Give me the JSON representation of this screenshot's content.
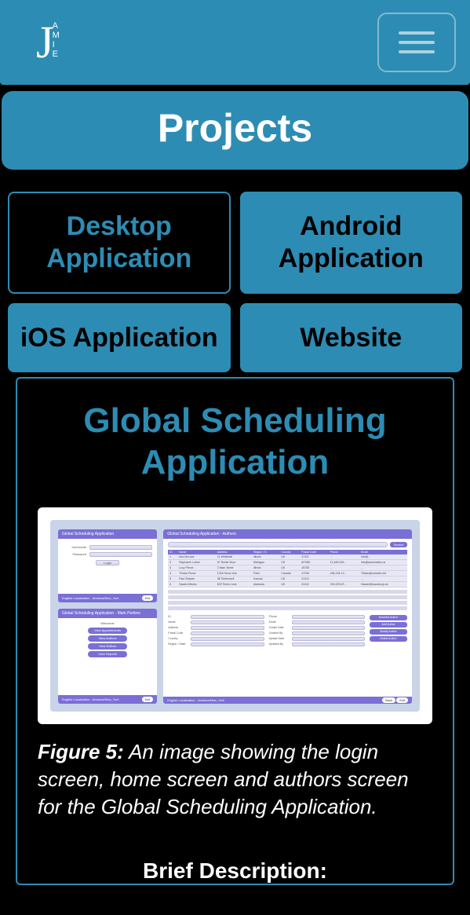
{
  "brand": {
    "letter": "J",
    "stack": [
      "A",
      "M",
      "I",
      "E"
    ]
  },
  "page_title": "Projects",
  "tabs": [
    {
      "label": "Desktop Application",
      "active": true
    },
    {
      "label": "Android Application",
      "active": false
    },
    {
      "label": "iOS Application",
      "active": false
    },
    {
      "label": "Website",
      "active": false
    }
  ],
  "project": {
    "title": "Global Scheduling Application",
    "figure_label": "Figure 5:",
    "figure_caption": "An image showing the login screen, home screen and authors screen for the Global Scheduling Application.",
    "brief_heading": "Brief Description:"
  },
  "mock": {
    "login_title": "Global Scheduling Application",
    "login_user": "Username",
    "login_pass": "Password",
    "login_btn": "Login",
    "footer_loc": "English Localization - America/New_York",
    "footer_pill": "Exit",
    "menu_title": "Global Scheduling Application - Mark Perkins",
    "menu_welcome": "Welcome!",
    "menu_items": [
      "View Appointments",
      "View Authors",
      "View Editors",
      "View Reports"
    ],
    "authors_title": "Global Scheduling Application - Authors",
    "search_btn": "Search",
    "table_headers": [
      "ID",
      "Name",
      "Address",
      "Region / S..",
      "Country",
      "Postal Code",
      "Phone",
      "Email"
    ],
    "table_rows": [
      [
        "1",
        "Ava McLane",
        "21 Whitehall",
        "Illinois",
        "US",
        "17321",
        "...",
        "info@..."
      ],
      [
        "2",
        "Stephanie Luthor",
        "67 Rustin Moor",
        "Michigan",
        "US",
        "AF18B",
        "11-445-515...",
        "info@automation.us"
      ],
      [
        "3",
        "Lucy Pierce",
        "2 Main Street",
        "Illinois",
        "US",
        "15735",
        "...",
        "..."
      ],
      [
        "4",
        "Tristan Pierce",
        "122A Huron Ave",
        "Paris",
        "Canada",
        "17245",
        "436-234-12...",
        "Tristan@canweb.net"
      ],
      [
        "5",
        "Paul Shepler",
        "38 Timberwell",
        "Kansas",
        "US",
        "21312",
        "...",
        "..."
      ],
      [
        "6",
        "Hazard Mkoko",
        "629 Times Lane",
        "Alabama",
        "US",
        "21312",
        "215-678-87...",
        "Hazard@socalcorp.za"
      ]
    ],
    "form_left": [
      "ID",
      "Name",
      "Address",
      "Postal Code",
      "Country",
      "Region / State"
    ],
    "form_right": [
      "Phone",
      "Email",
      "Create Date",
      "Created By",
      "Update Date",
      "Updated By"
    ],
    "actions": [
      "Deselect Author",
      "Add Author",
      "Modify Author",
      "Delete Author"
    ],
    "back_pill": "Back",
    "exit_pill": "Exit"
  }
}
